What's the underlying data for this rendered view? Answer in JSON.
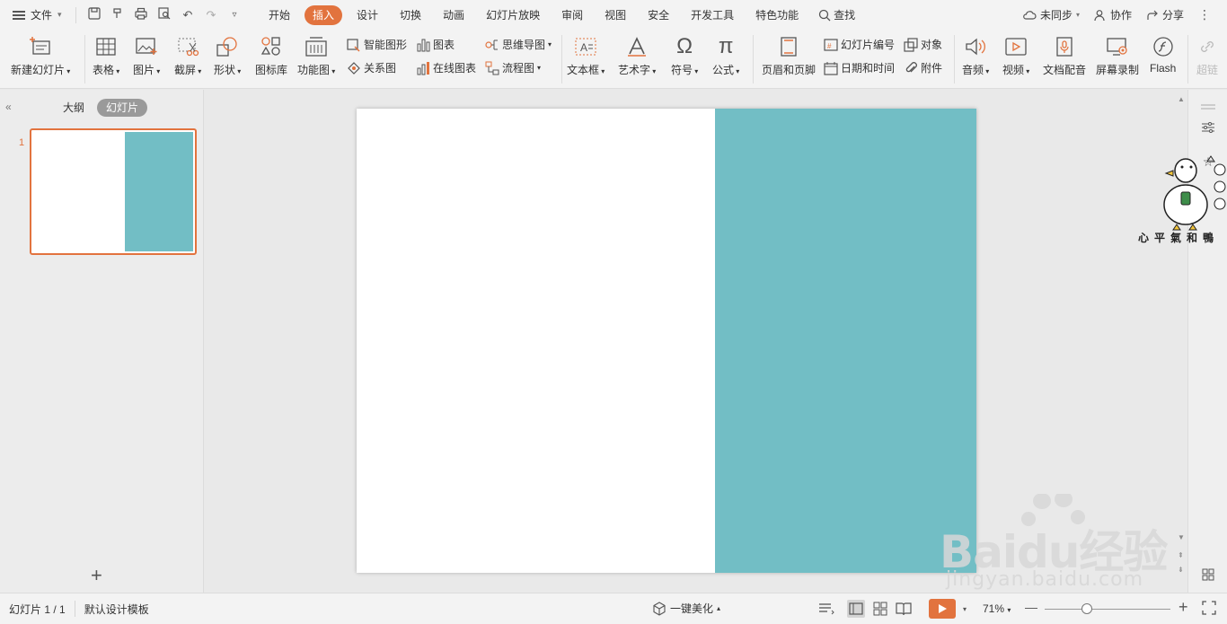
{
  "menubar": {
    "file_label": "文件",
    "tabs": [
      "开始",
      "插入",
      "设计",
      "切换",
      "动画",
      "幻灯片放映",
      "审阅",
      "视图",
      "安全",
      "开发工具",
      "特色功能"
    ],
    "active_tab": "插入",
    "search_label": "查找",
    "sync_label": "未同步",
    "collab_label": "协作",
    "share_label": "分享"
  },
  "ribbon": {
    "new_slide": "新建幻灯片",
    "table": "表格",
    "picture": "图片",
    "screenshot": "截屏",
    "shapes": "形状",
    "icon_library": "图标库",
    "function_chart": "功能图",
    "smart_shape": "智能图形",
    "chart": "图表",
    "relation_chart": "关系图",
    "online_chart": "在线图表",
    "mind_map": "思维导图",
    "flowchart": "流程图",
    "textbox": "文本框",
    "wordart": "艺术字",
    "symbol": "符号",
    "formula": "公式",
    "header_footer": "页眉和页脚",
    "slide_number": "幻灯片编号",
    "object": "对象",
    "date_time": "日期和时间",
    "attachment": "附件",
    "audio": "音频",
    "video": "视频",
    "doc_dubbing": "文档配音",
    "screen_record": "屏幕录制",
    "flash": "Flash",
    "hyperlink": "超链"
  },
  "leftpanel": {
    "outline_tab": "大纲",
    "slides_tab": "幻灯片",
    "slide_number": "1",
    "add_slide": "+"
  },
  "mascot": {
    "caption": "心平氣和鴨"
  },
  "watermark": {
    "main": "Baidu经验",
    "sub": "jingyan.baidu.com"
  },
  "statusbar": {
    "slide_info": "幻灯片 1 / 1",
    "template": "默认设计模板",
    "beautify": "一键美化",
    "zoom": "71%"
  },
  "colors": {
    "accent": "#e2733e",
    "slide_teal": "#72bec5"
  }
}
